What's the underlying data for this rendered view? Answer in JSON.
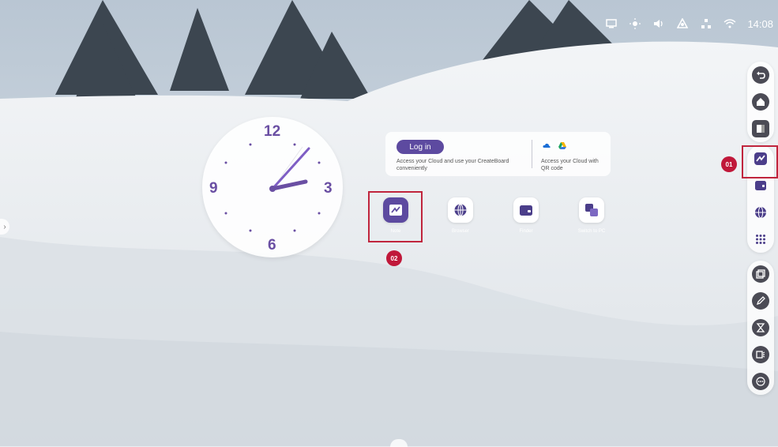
{
  "status_bar": {
    "icons": [
      "screen-share-icon",
      "brightness-icon",
      "volume-icon",
      "cloud-sync-icon",
      "ethernet-icon",
      "wifi-icon"
    ],
    "time": "14:08"
  },
  "clock": {
    "numerals": [
      "12",
      "3",
      "6",
      "9"
    ],
    "hour": 2,
    "minute": 8
  },
  "cloud_card": {
    "login_label": "Log in",
    "description": "Access your Cloud and use your CreateBoard conveniently",
    "qr_description": "Access your Cloud with QR code"
  },
  "apps": [
    {
      "label": "Note",
      "icon": "note-icon"
    },
    {
      "label": "Browser",
      "icon": "browser-icon"
    },
    {
      "label": "Finder",
      "icon": "finder-icon"
    },
    {
      "label": "Switch to PC",
      "icon": "switch-pc-icon"
    }
  ],
  "markers": {
    "m01": "01",
    "m02": "02"
  },
  "dock_top": [
    "back-icon",
    "home-icon",
    "window-icon"
  ],
  "dock_apps": [
    "note-icon",
    "finder-icon",
    "browser-icon",
    "apps-grid-icon"
  ],
  "dock_tools": [
    "screenshot-icon",
    "pen-icon",
    "timer-icon",
    "screen-record-icon",
    "more-icon"
  ],
  "colors": {
    "accent": "#5d4aa0",
    "highlight": "#c0253d",
    "marker": "#c0183a"
  }
}
